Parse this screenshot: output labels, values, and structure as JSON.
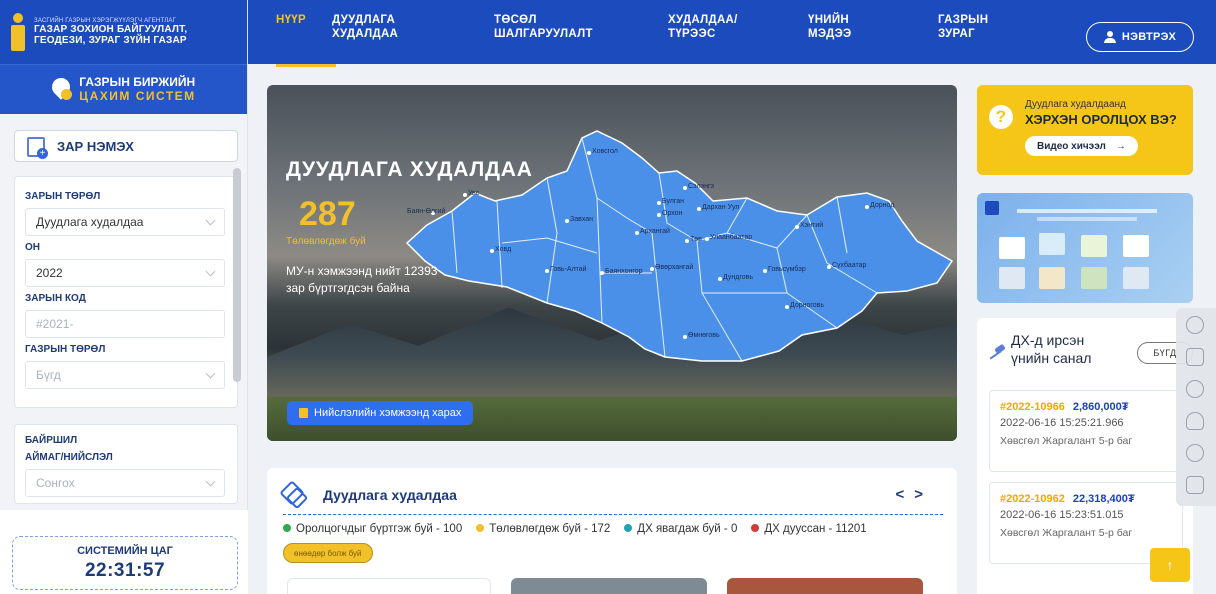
{
  "brand": {
    "agency_small": "ЗАСГИЙН ГАЗРЫН ХЭРЭГЖҮҮЛЭГЧ АГЕНТЛАГ",
    "agency_line1": "ГАЗАР ЗОХИОН БАЙГУУЛАЛТ,",
    "agency_line2": "ГЕОДЕЗИ, ЗУРАГ ЗҮЙН ГАЗАР",
    "exchange_line1": "ГАЗРЫН БИРЖИЙН",
    "exchange_line2": "ЦАХИМ СИСТЕМ"
  },
  "nav": {
    "items": [
      {
        "line1": "НҮҮР",
        "line2": ""
      },
      {
        "line1": "ДУУДЛАГА",
        "line2": "ХУДАЛДАА"
      },
      {
        "line1": "ТӨСӨЛ",
        "line2": "ШАЛГАРУУЛАЛТ"
      },
      {
        "line1": "ХУДАЛДАА/",
        "line2": "ТҮРЭЭС"
      },
      {
        "line1": "ҮНИЙН",
        "line2": "МЭДЭЭ"
      },
      {
        "line1": "ГАЗРЫН",
        "line2": "ЗУРАГ"
      }
    ],
    "login_label": "НЭВТРЭХ"
  },
  "sidebar": {
    "add_ad_label": "ЗАР НЭМЭХ",
    "filters": {
      "ad_type_label": "ЗАРЫН ТӨРӨЛ",
      "ad_type_value": "Дуудлага худалдаа",
      "year_label": "ОН",
      "year_value": "2022",
      "ad_code_label": "ЗАРЫН КОД",
      "ad_code_placeholder": "#2021-",
      "land_type_label": "ГАЗРЫН ТӨРӨЛ",
      "land_type_value": "Бүгд"
    },
    "location": {
      "label": "БАЙРШИЛ",
      "aimag_label": "АЙМАГ/НИЙСЛЭЛ",
      "aimag_value": "Сонгох"
    },
    "clock": {
      "label": "СИСТЕМИЙН ЦАГ",
      "time": "22:31:57"
    }
  },
  "hero": {
    "title": "ДУУДЛАГА ХУДАЛДАА",
    "count": "287",
    "count_label": "Төлөвлөгдөж буй",
    "description": "МУ-н хэмжээнд нийт 12393 зар бүртгэгдсэн байна",
    "city_button": "Нийслэлийн хэмжээнд харах",
    "provinces": [
      "Ховсгол",
      "Увс",
      "Баян-Өлгий",
      "Завхан",
      "Сэлэнгэ",
      "Дархан Уул",
      "Булган",
      "Орхон",
      "Хэнтий",
      "Дорнод",
      "Архангай",
      "Төв",
      "Улаанбаатар",
      "Ховд",
      "Говь-Алтай",
      "Баянхонгор",
      "Өвөрхангай",
      "Дундговь",
      "Говьсүмбэр",
      "Сүхбаатар",
      "Дорноговь",
      "Өмнөговь"
    ]
  },
  "auction": {
    "title": "Дуудлага худалдаа",
    "legend": [
      {
        "label": "Оролцогчдыг бүртгэж буй - 100",
        "color": "#2fa84f"
      },
      {
        "label": "Төлөвлөгдөж буй - 172",
        "color": "#f2c028"
      },
      {
        "label": "ДХ явагдаж буй - 0",
        "color": "#1fa3b3"
      },
      {
        "label": "ДХ дууссан - 11201",
        "color": "#d33a3a"
      }
    ],
    "today_tag": "өнөөдөр болж буй"
  },
  "right": {
    "howto_line1": "Дуудлага худалдаанд",
    "howto_line2": "ХЭРХЭН ОРОЛЦОХ ВЭ?",
    "video_label": "Видео хичээл",
    "offers_title_line1": "ДХ-д ирсэн",
    "offers_title_line2": "үнийн санал",
    "all_label": "БҮГД",
    "offers": [
      {
        "id": "#2022-10966",
        "price": "2,860,000₮",
        "date": "2022-06-16 15:25:21.966",
        "place": "Хөвсгөл Жаргалант 5-р баг"
      },
      {
        "id": "#2022-10962",
        "price": "22,318,400₮",
        "date": "2022-06-16 15:23:51.015",
        "place": "Хөвсгөл Жаргалант 5-р баг"
      }
    ]
  },
  "colors": {
    "brand_blue": "#1b4bbd",
    "accent_yellow": "#f2c028",
    "map_blue": "#4a90e8"
  }
}
